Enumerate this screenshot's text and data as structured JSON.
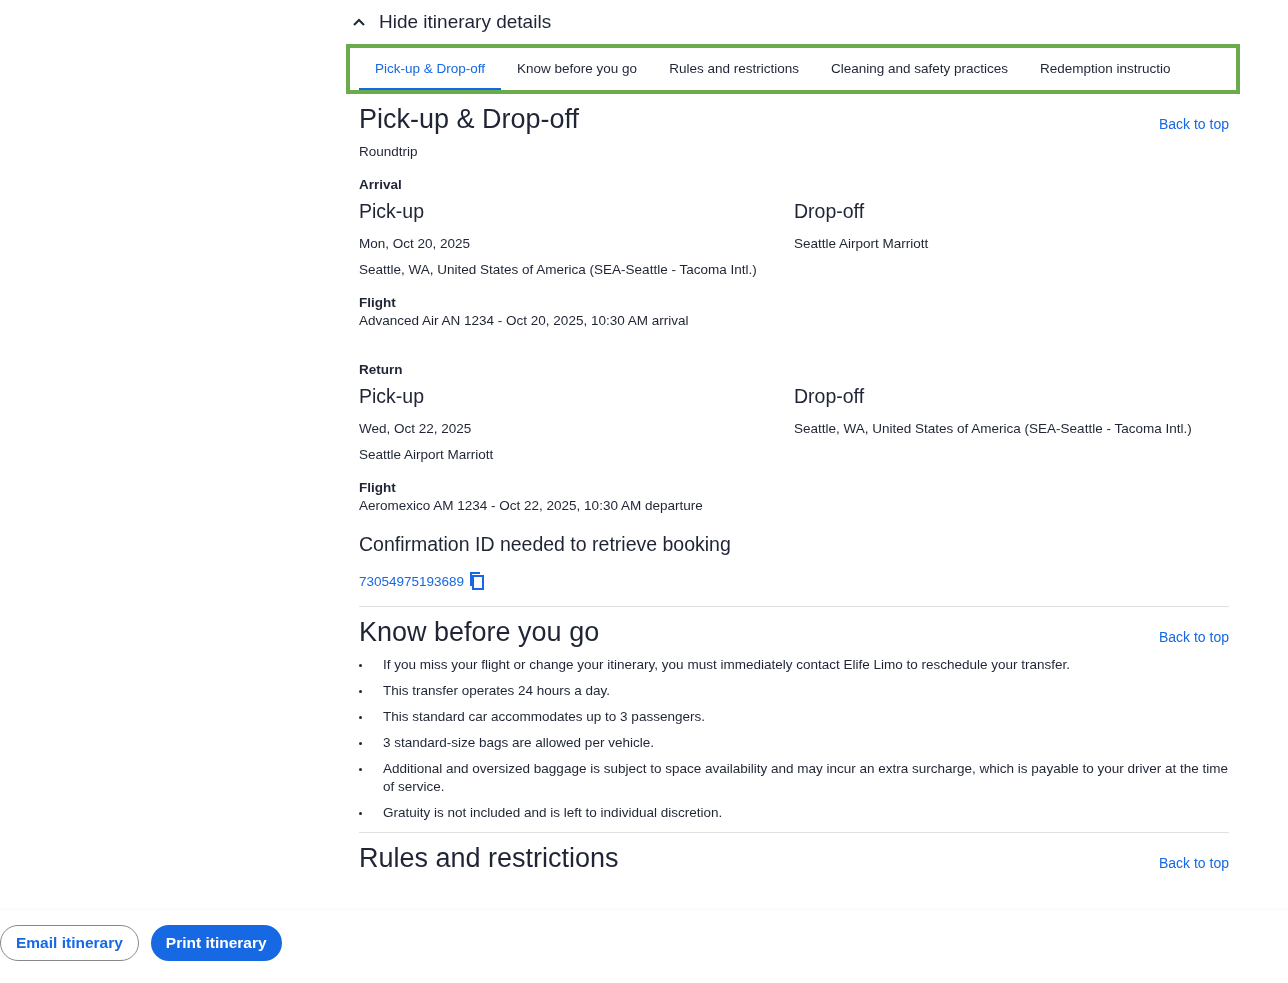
{
  "toggle": {
    "label": "Hide itinerary details",
    "expanded": true
  },
  "tabs": [
    {
      "label": "Pick-up & Drop-off",
      "selected": true
    },
    {
      "label": "Know before you go",
      "selected": false
    },
    {
      "label": "Rules and restrictions",
      "selected": false
    },
    {
      "label": "Cleaning and safety practices",
      "selected": false
    },
    {
      "label": "Redemption instructio",
      "selected": false
    }
  ],
  "pickup_section": {
    "title": "Pick-up & Drop-off",
    "back_link": "Back to top",
    "trip_type": "Roundtrip",
    "legs": [
      {
        "label": "Arrival",
        "pickup": {
          "title": "Pick-up",
          "lines": [
            "Mon, Oct 20, 2025",
            "Seattle, WA, United States of America (SEA-Seattle - Tacoma Intl.)"
          ]
        },
        "dropoff": {
          "title": "Drop-off",
          "lines": [
            "Seattle Airport Marriott"
          ]
        },
        "flight_label": "Flight",
        "flight": "Advanced Air AN 1234 - Oct 20, 2025, 10:30 AM arrival"
      },
      {
        "label": "Return",
        "pickup": {
          "title": "Pick-up",
          "lines": [
            "Wed, Oct 22, 2025",
            "Seattle Airport Marriott"
          ]
        },
        "dropoff": {
          "title": "Drop-off",
          "lines": [
            "Seattle, WA, United States of America (SEA-Seattle - Tacoma Intl.)"
          ]
        },
        "flight_label": "Flight",
        "flight": "Aeromexico AM 1234 - Oct 22, 2025, 10:30 AM departure"
      }
    ],
    "confirmation_title": "Confirmation ID needed to retrieve booking",
    "confirmation_id": "73054975193689"
  },
  "know_section": {
    "title": "Know before you go",
    "back_link": "Back to top",
    "bullets": [
      "If you miss your flight or change your itinerary, you must immediately contact Elife Limo to reschedule your transfer.",
      "This transfer operates 24 hours a day.",
      "This standard car accommodates up to 3 passengers.",
      "3 standard-size bags are allowed per vehicle.",
      "Additional and oversized baggage is subject to space availability and may incur an extra surcharge, which is payable to your driver at the time of service.",
      "Gratuity is not included and is left to individual discretion."
    ]
  },
  "rules_section": {
    "title": "Rules and restrictions",
    "back_link": "Back to top"
  },
  "footer": {
    "email_button": "Email itinerary",
    "print_button": "Print itinerary"
  }
}
